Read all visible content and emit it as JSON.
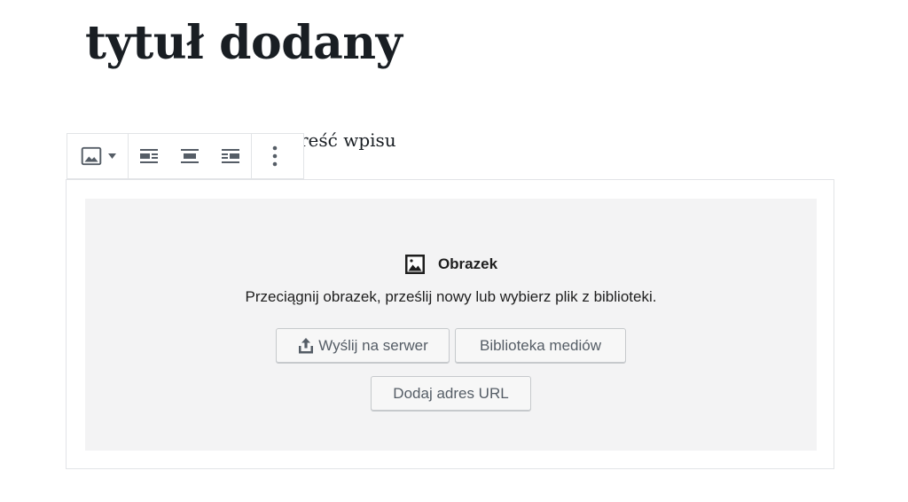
{
  "post": {
    "title": "tytuł dodany",
    "content_visible": "reść wpisu"
  },
  "toolbar": {
    "items": [
      {
        "name": "block-type-switcher",
        "icon": "image-icon",
        "has_dropdown": true
      },
      {
        "name": "align-left",
        "icon": "align-left-icon"
      },
      {
        "name": "align-center",
        "icon": "align-center-icon"
      },
      {
        "name": "align-right",
        "icon": "align-right-icon"
      },
      {
        "name": "more-options",
        "icon": "more-vertical-icon"
      }
    ]
  },
  "image_block": {
    "label": "Obrazek",
    "icon": "image-icon",
    "instructions": "Przeciągnij obrazek, prześlij nowy lub wybierz plik z biblioteki.",
    "buttons": {
      "upload": "Wyślij na serwer",
      "media_library": "Biblioteka mediów",
      "insert_url": "Dodaj adres URL"
    }
  },
  "colors": {
    "text": "#1e1e1e",
    "placeholder_bg": "#f3f3f4",
    "border": "#e2e4e7",
    "button_bg": "#f7f7f7",
    "button_text": "#555d66"
  }
}
